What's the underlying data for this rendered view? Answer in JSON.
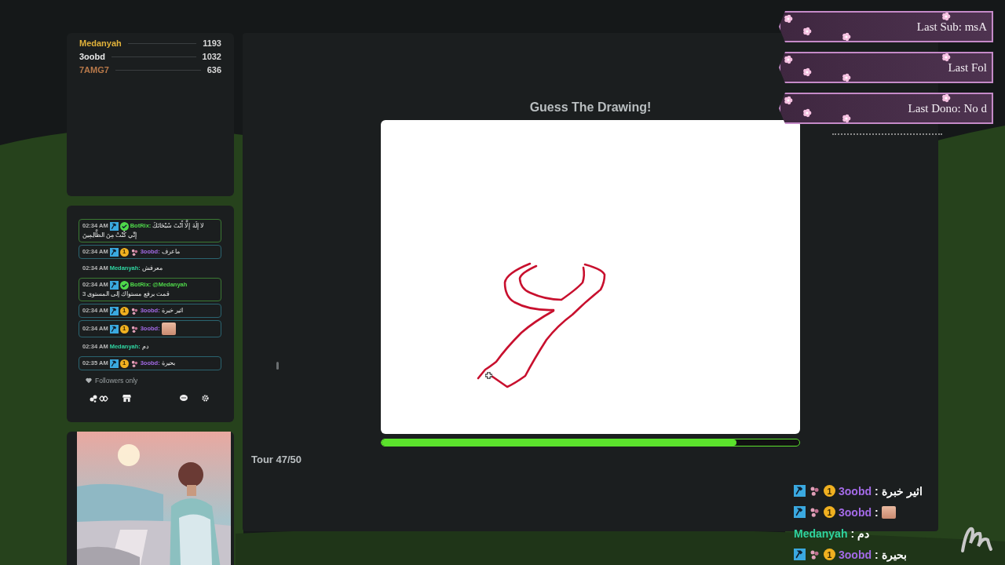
{
  "leaderboard": [
    {
      "name": "Medanyah",
      "score": "1193",
      "color": "#e0b13a"
    },
    {
      "name": "3oobd",
      "score": "1032",
      "color": "#e8e8e8"
    },
    {
      "name": "7AMG7",
      "score": "636",
      "color": "#b8794a"
    }
  ],
  "chat": {
    "messages": [
      {
        "time": "02:34 AM",
        "kind": "bot",
        "badges": [
          {
            "kind": "mod"
          },
          {
            "kind": "verified"
          }
        ],
        "user": "BotRix:",
        "color": "#4fd84a",
        "text": "لا إِلَهَ إِلَّا أَنْتَ سُبْحَانَكَ",
        "continuation": "إِنِّي كُنْتُ مِنَ الظَّالِمِينَ",
        "emote": false
      },
      {
        "time": "02:34 AM",
        "kind": "sub",
        "badges": [
          {
            "kind": "mod"
          },
          {
            "kind": "coin",
            "label": "1"
          },
          {
            "kind": "paw"
          }
        ],
        "user": "3oobd:",
        "color": "#a36ae6",
        "text": "ماعرف",
        "emote": false
      },
      {
        "time": "02:34 AM",
        "kind": "plain",
        "user": "Medanyah:",
        "color": "#2fd3a0",
        "text": "معرفش",
        "emote": false
      },
      {
        "time": "02:34 AM",
        "kind": "bot",
        "badges": [
          {
            "kind": "mod"
          },
          {
            "kind": "verified"
          }
        ],
        "user": "BotRix:",
        "color": "#4fd84a",
        "mention": "@Medanyah",
        "continuation": "قمت برفع مستواك إلى المستوى 3",
        "emote": false
      },
      {
        "time": "02:34 AM",
        "kind": "sub",
        "badges": [
          {
            "kind": "mod"
          },
          {
            "kind": "coin",
            "label": "1"
          },
          {
            "kind": "paw"
          }
        ],
        "user": "3oobd:",
        "color": "#a36ae6",
        "text": "اثير خبرة",
        "emote": false
      },
      {
        "time": "02:34 AM",
        "kind": "sub",
        "badges": [
          {
            "kind": "mod"
          },
          {
            "kind": "coin",
            "label": "1"
          },
          {
            "kind": "paw"
          }
        ],
        "user": "3oobd:",
        "color": "#a36ae6",
        "emote": true
      },
      {
        "time": "02:34 AM",
        "kind": "plain",
        "user": "Medanyah:",
        "color": "#2fd3a0",
        "text": "دم",
        "emote": false
      },
      {
        "time": "02:35 AM",
        "kind": "sub",
        "badges": [
          {
            "kind": "mod"
          },
          {
            "kind": "coin",
            "label": "1"
          },
          {
            "kind": "paw"
          }
        ],
        "user": "3oobd:",
        "color": "#a36ae6",
        "text": "بحيرة",
        "emote": false
      }
    ],
    "mode": "Followers only"
  },
  "game": {
    "title": "Guess The Drawing!",
    "timer": {
      "level": 0.85
    },
    "round": "Tour 47/50"
  },
  "alerts": [
    {
      "text": "Last Sub: msA"
    },
    {
      "text": "Last Fol"
    },
    {
      "text": "Last Dono: No d"
    }
  ],
  "overlay_chat": [
    {
      "badges": [
        {
          "kind": "mod"
        },
        {
          "kind": "paw"
        },
        {
          "kind": "coin",
          "label": "1"
        }
      ],
      "user": "3oobd",
      "color": "#a36ae6",
      "separator": ":",
      "text": "اثير خبرة",
      "emote": false
    },
    {
      "badges": [
        {
          "kind": "mod"
        },
        {
          "kind": "paw"
        },
        {
          "kind": "coin",
          "label": "1"
        }
      ],
      "user": "3oobd",
      "color": "#a36ae6",
      "separator": ":",
      "emote": true
    },
    {
      "user": "Medanyah",
      "color": "#2fd3a0",
      "separator": ":",
      "text": "دم",
      "emote": false
    },
    {
      "badges": [
        {
          "kind": "mod"
        },
        {
          "kind": "paw"
        },
        {
          "kind": "coin",
          "label": "1"
        }
      ],
      "user": "3oobd",
      "color": "#a36ae6",
      "separator": ":",
      "text": "بحيرة",
      "emote": false
    }
  ]
}
